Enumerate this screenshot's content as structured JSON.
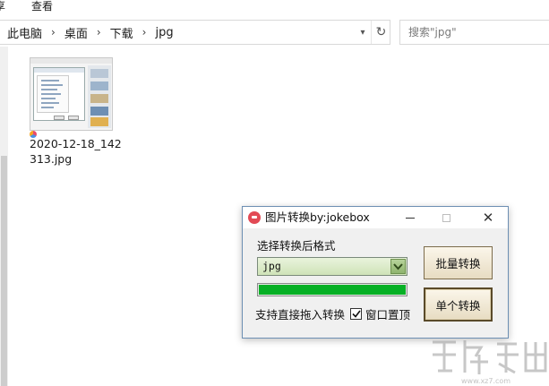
{
  "explorer": {
    "ribbon": {
      "tab_share": "享",
      "tab_view": "查看"
    },
    "address_bar": {
      "crumbs": [
        "此电脑",
        "桌面",
        "下载",
        "jpg"
      ],
      "separator": ">"
    },
    "search": {
      "placeholder": "搜索\"jpg\""
    },
    "files": [
      {
        "name": "2020-12-18_142313.jpg",
        "icon": "image-thumbnail-icon"
      }
    ]
  },
  "dialog": {
    "title": "图片转换by:jokebox",
    "icon": "app-icon",
    "controls": {
      "minimize": "—",
      "maximize": "□",
      "close": "✕"
    },
    "format_label": "选择转换后格式",
    "format_value": "jpg",
    "progress": 1.0,
    "progress_color": "#06b025",
    "drag_label": "支持直接拖入转换",
    "topmost_label": "窗口置顶",
    "topmost_checked": true,
    "batch_button": "批量转换",
    "single_button": "单个转换"
  },
  "colors": {
    "dialog_bg": "#f0f0f0",
    "combo_green": "#cfe3b8",
    "progress_green": "#06b025",
    "button_face": "#e7dcc2"
  }
}
